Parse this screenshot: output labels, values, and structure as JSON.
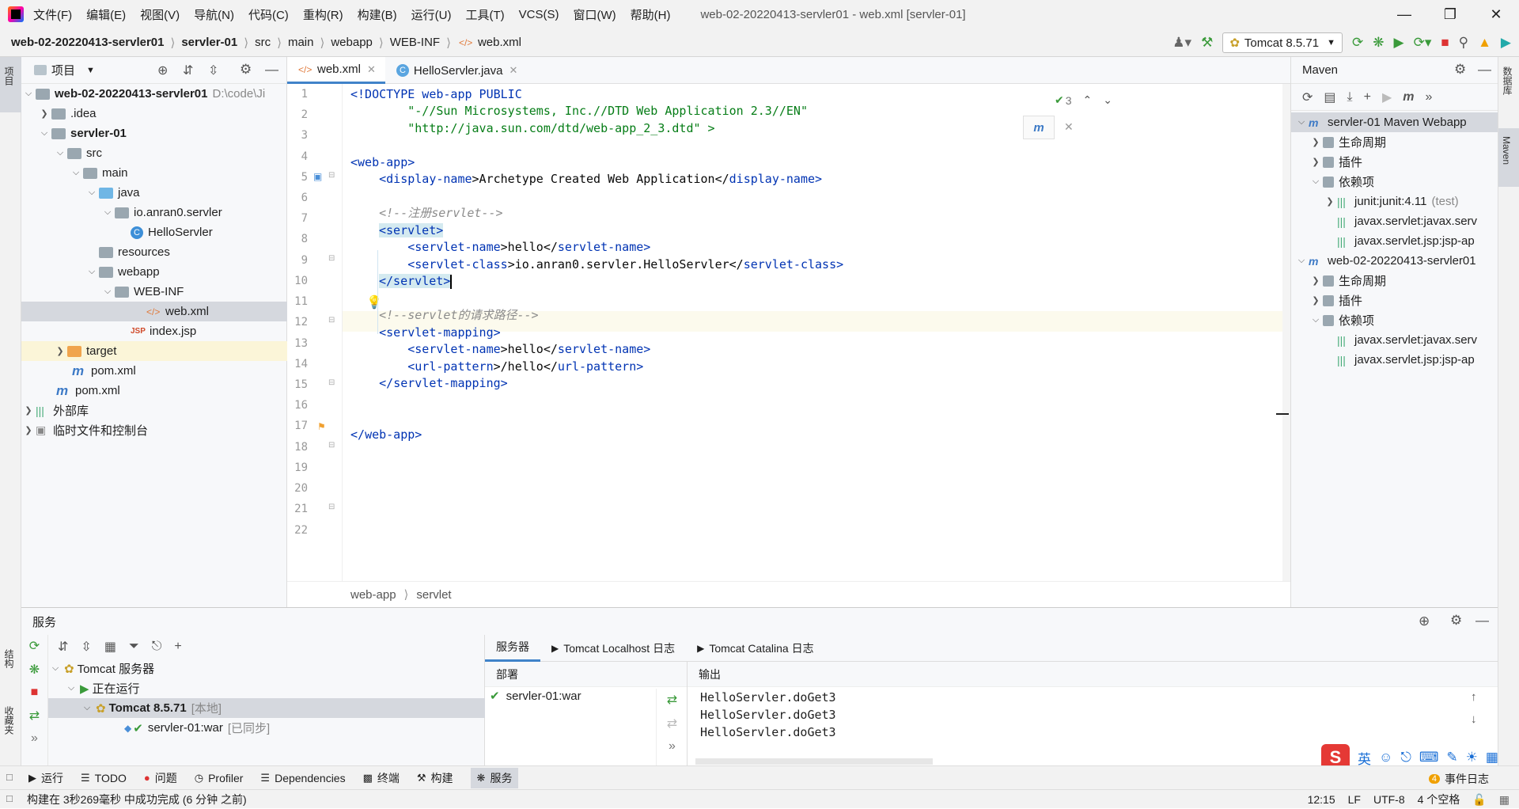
{
  "titlebar": {
    "menus": [
      "文件(F)",
      "编辑(E)",
      "视图(V)",
      "导航(N)",
      "代码(C)",
      "重构(R)",
      "构建(B)",
      "运行(U)",
      "工具(T)",
      "VCS(S)",
      "窗口(W)",
      "帮助(H)"
    ],
    "window_title": "web-02-20220413-servler01 - web.xml [servler-01]"
  },
  "navbar": {
    "crumbs": [
      "web-02-20220413-servler01",
      "servler-01",
      "src",
      "main",
      "webapp",
      "WEB-INF",
      "web.xml"
    ],
    "run_config": "Tomcat 8.5.71"
  },
  "left_strip": {
    "tabs": [
      "项目",
      "结构",
      "收藏夹"
    ]
  },
  "right_strip": {
    "tabs": [
      "数据库",
      "Maven"
    ]
  },
  "project": {
    "title": "项目",
    "tree": [
      {
        "label": "web-02-20220413-servler01",
        "extra": "D:\\code\\Ji",
        "bold": true
      },
      {
        "label": ".idea"
      },
      {
        "label": "servler-01",
        "bold": true
      },
      {
        "label": "src"
      },
      {
        "label": "main"
      },
      {
        "label": "java"
      },
      {
        "label": "io.anran0.servler"
      },
      {
        "label": "HelloServler"
      },
      {
        "label": "resources"
      },
      {
        "label": "webapp"
      },
      {
        "label": "WEB-INF"
      },
      {
        "label": "web.xml"
      },
      {
        "label": "index.jsp"
      },
      {
        "label": "target"
      },
      {
        "label": "pom.xml"
      },
      {
        "label": "pom.xml"
      },
      {
        "label": "外部库"
      },
      {
        "label": "临时文件和控制台"
      }
    ]
  },
  "editor": {
    "tabs": [
      {
        "label": "web.xml"
      },
      {
        "label": "HelloServler.java"
      }
    ],
    "inspection_count": "3",
    "line_numbers": [
      "1",
      "2",
      "3",
      "4",
      "5",
      "6",
      "7",
      "8",
      "9",
      "10",
      "11",
      "12",
      "13",
      "14",
      "15",
      "16",
      "17",
      "18",
      "19",
      "20",
      "21",
      "22"
    ],
    "code": {
      "l1": "<!DOCTYPE web-app PUBLIC",
      "l2": "        \"-//Sun Microsystems, Inc.//DTD Web Application 2.3//EN\"",
      "l3": "        \"http://java.sun.com/dtd/web-app_2_3.dtd\" >",
      "l5": "<web-app>",
      "l6a": "    <",
      "l6b": "display-name",
      "l6c": ">Archetype Created Web Application</",
      "l6d": "display-name",
      "l6e": ">",
      "l8": "    <!--注册servlet-->",
      "l9": "<servlet>",
      "l10a": "        <",
      "l10b": "servlet-name",
      "l10c": ">hello</",
      "l10d": "servlet-name",
      "l10e": ">",
      "l11a": "        <",
      "l11b": "servlet-class",
      "l11c": ">io.anran0.servler.HelloServler</",
      "l11d": "servlet-class",
      "l11e": ">",
      "l12": "</servlet>",
      "l14": "    <!--servlet的请求路径-->",
      "l15a": "    <",
      "l15b": "servlet-mapping",
      "l15c": ">",
      "l16a": "        <",
      "l16b": "servlet-name",
      "l16c": ">hello</",
      "l16d": "servlet-name",
      "l16e": ">",
      "l17a": "        <",
      "l17b": "url-pattern",
      "l17c": ">/hello</",
      "l17d": "url-pattern",
      "l17e": ">",
      "l18a": "    </",
      "l18b": "servlet-mapping",
      "l18c": ">",
      "l21a": "</",
      "l21b": "web-app",
      "l21c": ">"
    },
    "breadcrumb": [
      "web-app",
      "servlet"
    ]
  },
  "maven": {
    "title": "Maven",
    "tree": [
      {
        "label": "servler-01 Maven Webapp"
      },
      {
        "label": "生命周期"
      },
      {
        "label": "插件"
      },
      {
        "label": "依赖项"
      },
      {
        "label": "junit:junit:4.11",
        "extra": "(test)"
      },
      {
        "label": "javax.servlet:javax.serv"
      },
      {
        "label": "javax.servlet.jsp:jsp-ap"
      },
      {
        "label": "web-02-20220413-servler01"
      },
      {
        "label": "生命周期"
      },
      {
        "label": "插件"
      },
      {
        "label": "依赖项"
      },
      {
        "label": "javax.servlet:javax.serv"
      },
      {
        "label": "javax.servlet.jsp:jsp-ap"
      }
    ]
  },
  "services": {
    "title": "服务",
    "tree": [
      {
        "label": "Tomcat 服务器"
      },
      {
        "label": "正在运行"
      },
      {
        "label": "Tomcat 8.5.71",
        "extra": "[本地]"
      },
      {
        "label": "servler-01:war",
        "extra": "[已同步]"
      }
    ],
    "tabs": [
      "服务器",
      "Tomcat Localhost 日志",
      "Tomcat Catalina 日志"
    ],
    "deploy_header": "部署",
    "deploy_item": "servler-01:war",
    "output_header": "输出",
    "output_lines": [
      "HelloServler.doGet3",
      "HelloServler.doGet3",
      "HelloServler.doGet3"
    ]
  },
  "bottom_tabs": [
    "运行",
    "TODO",
    "问题",
    "Profiler",
    "Dependencies",
    "终端",
    "构建",
    "服务"
  ],
  "status": {
    "message": "构建在 3秒269毫秒 中成功完成 (6 分钟 之前)",
    "position": "12:15",
    "line_sep": "LF",
    "encoding": "UTF-8",
    "indent": "4 个空格",
    "events_count": "4",
    "events_label": "事件日志"
  },
  "ime": {
    "lang": "英"
  }
}
